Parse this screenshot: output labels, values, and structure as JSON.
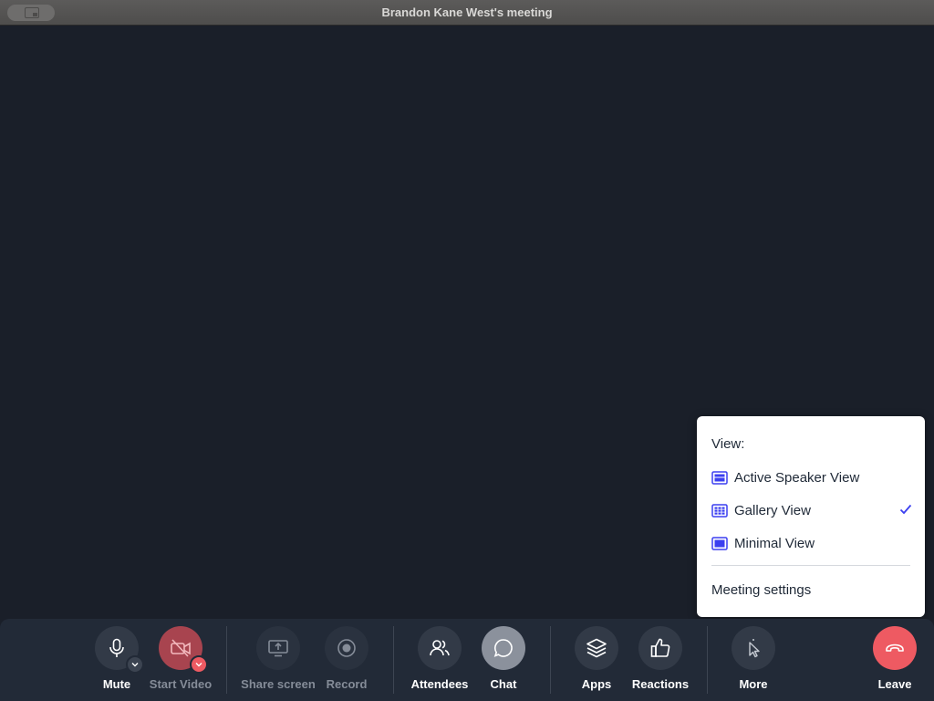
{
  "window": {
    "title": "Brandon Kane West's meeting"
  },
  "toolbar": {
    "mute": "Mute",
    "start_video": "Start Video",
    "share_screen": "Share screen",
    "record": "Record",
    "attendees": "Attendees",
    "chat": "Chat",
    "apps": "Apps",
    "reactions": "Reactions",
    "more": "More",
    "leave": "Leave"
  },
  "view_menu": {
    "heading": "View:",
    "items": [
      {
        "label": "Active Speaker View",
        "icon": "active-speaker-icon",
        "checked": false
      },
      {
        "label": "Gallery View",
        "icon": "gallery-grid-icon",
        "checked": true
      },
      {
        "label": "Minimal View",
        "icon": "minimal-view-icon",
        "checked": false
      }
    ],
    "settings": "Meeting settings"
  },
  "colors": {
    "stage_bg": "#1a1f29",
    "toolbar_bg": "#222a37",
    "leave_red": "#ee5a62",
    "accent_blue": "#3b3ff0"
  }
}
